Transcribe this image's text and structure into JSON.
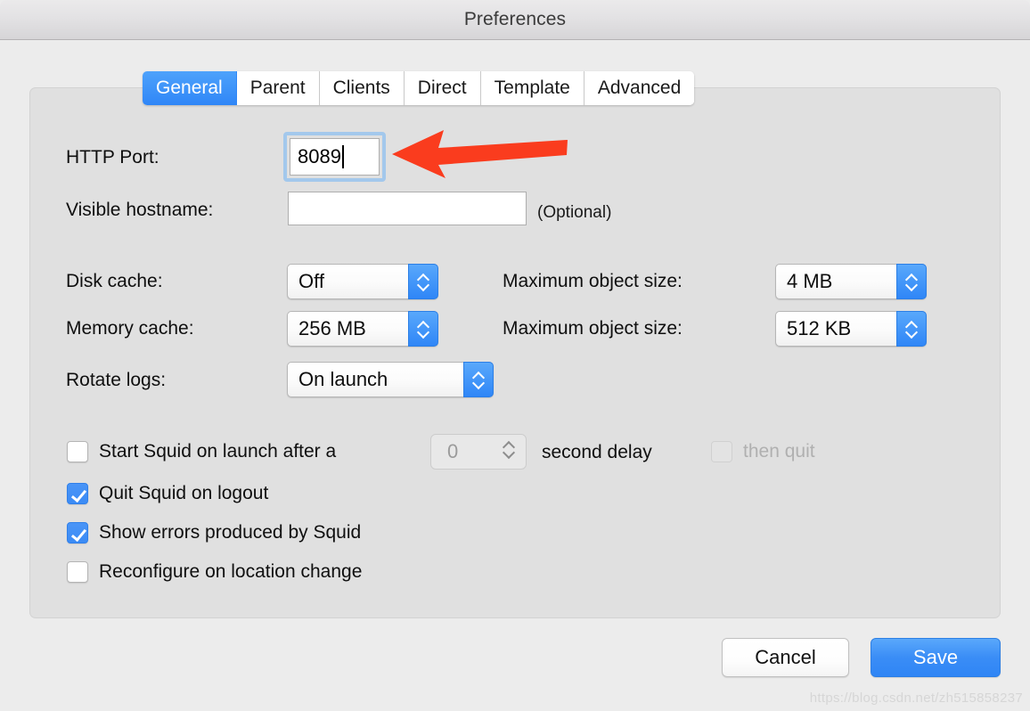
{
  "window": {
    "title": "Preferences"
  },
  "tabs": [
    {
      "label": "General",
      "active": true
    },
    {
      "label": "Parent",
      "active": false
    },
    {
      "label": "Clients",
      "active": false
    },
    {
      "label": "Direct",
      "active": false
    },
    {
      "label": "Template",
      "active": false
    },
    {
      "label": "Advanced",
      "active": false
    }
  ],
  "fields": {
    "http_port": {
      "label": "HTTP Port:",
      "value": "8089",
      "focused": true
    },
    "visible_hostname": {
      "label": "Visible hostname:",
      "value": "",
      "hint": "(Optional)"
    },
    "disk_cache": {
      "label": "Disk cache:",
      "value": "Off"
    },
    "disk_max_object_size": {
      "label": "Maximum object size:",
      "value": "4 MB"
    },
    "memory_cache": {
      "label": "Memory cache:",
      "value": "256 MB"
    },
    "memory_max_object_size": {
      "label": "Maximum object size:",
      "value": "512 KB"
    },
    "rotate_logs": {
      "label": "Rotate logs:",
      "value": "On launch"
    }
  },
  "checkboxes": {
    "start_on_launch": {
      "label": "Start Squid on launch after a",
      "checked": false,
      "delay_value": "0",
      "delay_suffix": "second delay",
      "then_quit_label": "then quit",
      "then_quit_checked": false,
      "then_quit_disabled": true
    },
    "quit_on_logout": {
      "label": "Quit Squid on logout",
      "checked": true
    },
    "show_errors": {
      "label": "Show errors produced by Squid",
      "checked": true
    },
    "reconfigure_on_location_change": {
      "label": "Reconfigure on location change",
      "checked": false
    }
  },
  "buttons": {
    "cancel": "Cancel",
    "save": "Save"
  },
  "annotation": {
    "arrow_color": "#fa3c1e",
    "points_to": "http-port-input"
  },
  "watermark": "https://blog.csdn.net/zh515858237",
  "colors": {
    "accent_blue": "#3b8bf5",
    "window_bg": "#ececec",
    "panel_bg": "#e0e0e0",
    "focus_ring": "#a3c8ec"
  }
}
